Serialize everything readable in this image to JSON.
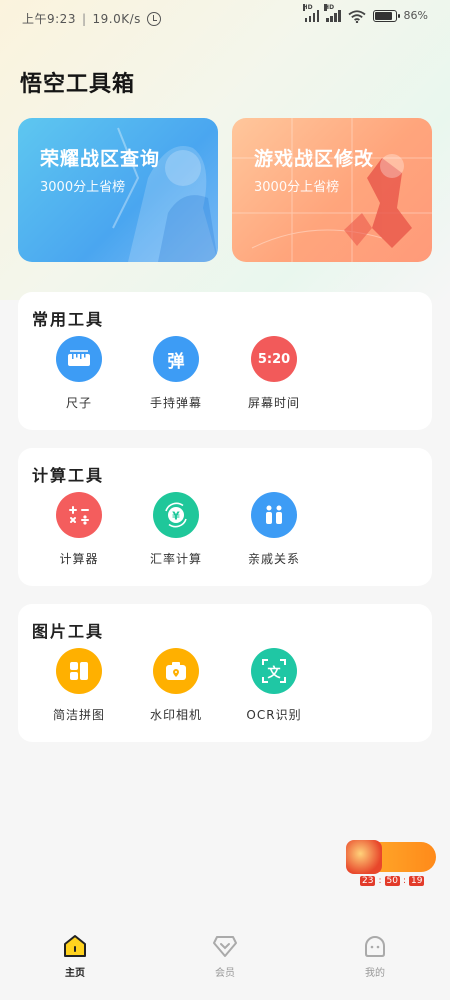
{
  "status_bar": {
    "time": "上午9:23",
    "speed": "19.0K/s",
    "battery": "86%"
  },
  "app": {
    "title": "悟空工具箱"
  },
  "banners": [
    {
      "title": "荣耀战区查询",
      "subtitle": "3000分上省榜",
      "color": "#4aa6f0"
    },
    {
      "title": "游戏战区修改",
      "subtitle": "3000分上省榜",
      "color": "#ffa57c"
    }
  ],
  "sections": [
    {
      "title": "常用工具",
      "tools": [
        {
          "label": "尺子",
          "icon": "ruler-icon",
          "color": "#3d9cf5"
        },
        {
          "label": "手持弹幕",
          "icon": "danmaku-icon",
          "icon_text": "弹",
          "color": "#3d9cf5"
        },
        {
          "label": "屏幕时间",
          "icon": "screen-time-icon",
          "icon_text": "5:20",
          "color": "#f25a5a"
        }
      ]
    },
    {
      "title": "计算工具",
      "tools": [
        {
          "label": "计算器",
          "icon": "calculator-icon",
          "color": "#f45d5d"
        },
        {
          "label": "汇率计算",
          "icon": "exchange-rate-icon",
          "color": "#1fc79a"
        },
        {
          "label": "亲戚关系",
          "icon": "relatives-icon",
          "color": "#3d9cf5"
        }
      ]
    },
    {
      "title": "图片工具",
      "tools": [
        {
          "label": "简洁拼图",
          "icon": "collage-icon",
          "color": "#ffb000"
        },
        {
          "label": "水印相机",
          "icon": "watermark-camera-icon",
          "color": "#ffb000"
        },
        {
          "label": "OCR识别",
          "icon": "ocr-icon",
          "icon_text": "文",
          "color": "#1fc7a4"
        }
      ]
    }
  ],
  "promo": {
    "timer": [
      "23",
      "50",
      "19"
    ]
  },
  "bottom_nav": [
    {
      "label": "主页",
      "icon": "home-icon",
      "active": true
    },
    {
      "label": "会员",
      "icon": "vip-diamond-icon",
      "active": false
    },
    {
      "label": "我的",
      "icon": "profile-face-icon",
      "active": false
    }
  ]
}
